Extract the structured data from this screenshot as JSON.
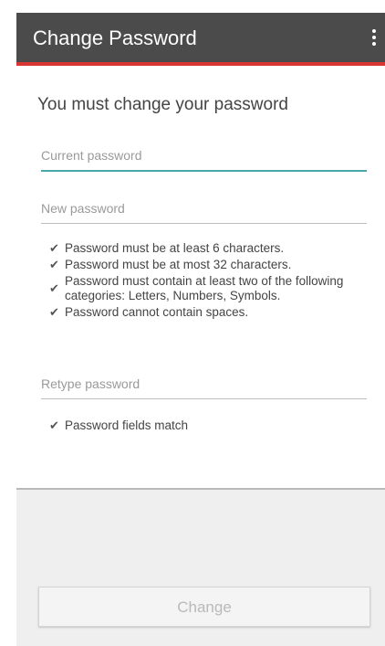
{
  "app_bar": {
    "title": "Change Password",
    "menu_icon": "more-vert-icon"
  },
  "form": {
    "heading": "You must change your password",
    "current_password": {
      "value": "",
      "placeholder": "Current password"
    },
    "new_password": {
      "value": "",
      "placeholder": "New password"
    },
    "rules": [
      {
        "text": "Password must be at least 6 characters.",
        "met": true
      },
      {
        "text": "Password must be at most 32 characters.",
        "met": true
      },
      {
        "text": "Password must contain at least two of the following categories: Letters, Numbers, Symbols.",
        "met": true
      },
      {
        "text": "Password cannot contain spaces.",
        "met": true
      }
    ],
    "retype_password": {
      "value": "",
      "placeholder": "Retype password"
    },
    "match_rules": [
      {
        "text": "Password fields match",
        "met": true
      }
    ],
    "check_glyph": "✔"
  },
  "actions": {
    "change_label": "Change",
    "change_enabled": false
  },
  "colors": {
    "app_bar": "#4b4b4b",
    "accent_line": "#d93633",
    "focus_underline": "#4aa9a5",
    "disabled_text": "#b9b9b9"
  }
}
